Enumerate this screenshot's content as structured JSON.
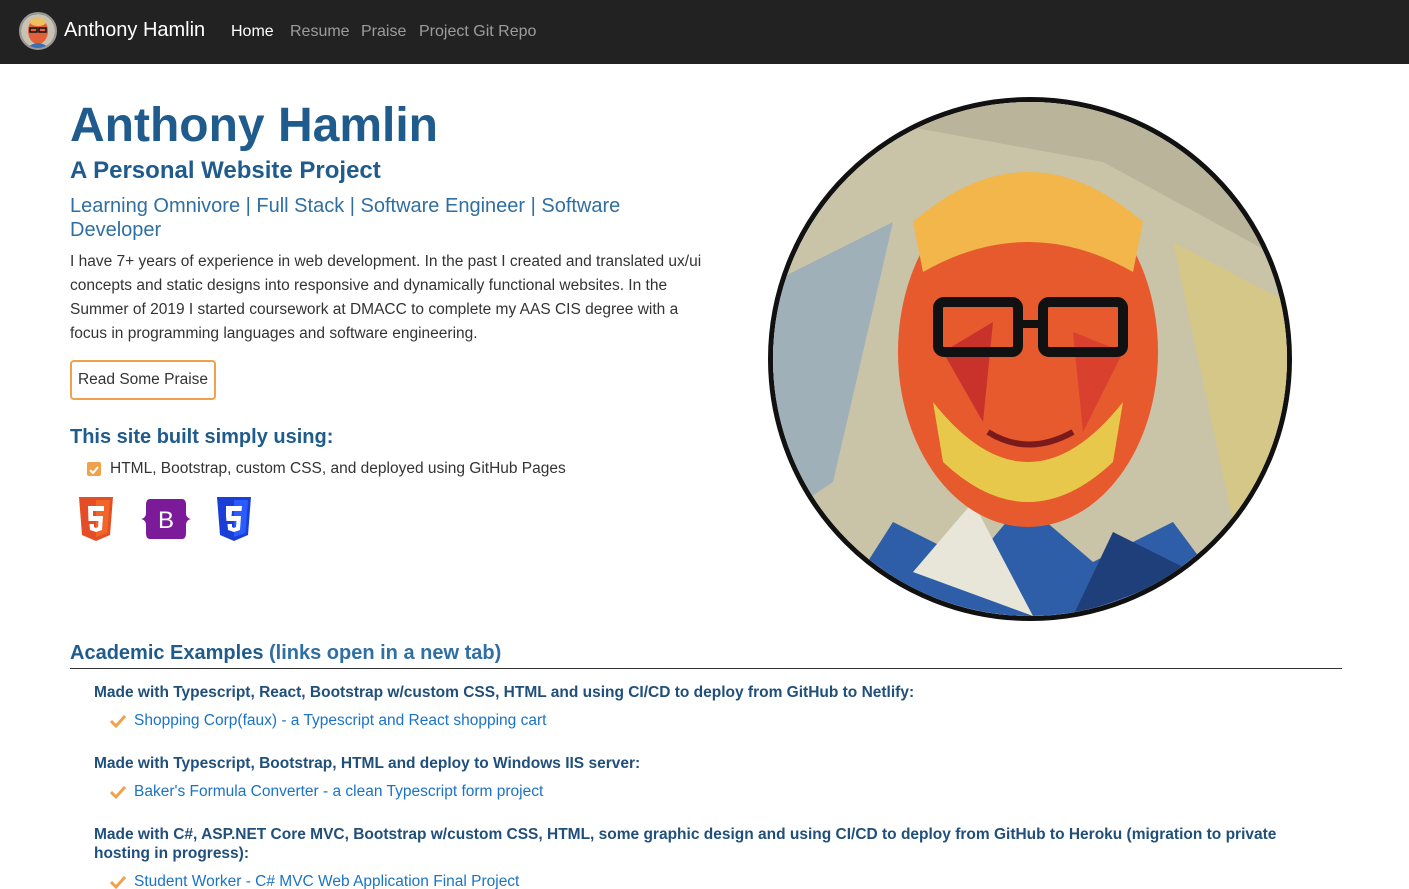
{
  "nav": {
    "brand": "Anthony Hamlin",
    "links": [
      "Home",
      "Resume",
      "Praise",
      "Project Git Repo"
    ]
  },
  "hero": {
    "title": "Anthony Hamlin",
    "subtitle": "A Personal Website Project",
    "tagline": "Learning Omnivore | Full Stack | Software Engineer | Software Developer",
    "description": "I have 7+ years of experience in web development. In the past I created and translated ux/ui concepts and static designs into responsive and dynamically functional websites. In the Summer of 2019 I started coursework at DMACC to complete my AAS CIS degree with a focus in programming languages and software engineering.",
    "button": "Read Some Praise"
  },
  "built": {
    "title": "This site built simply using:",
    "item": "HTML, Bootstrap, custom CSS, and deployed using GitHub Pages",
    "icons": [
      "html5-icon",
      "bootstrap-icon",
      "css3-icon"
    ],
    "bootstrap_letter": "B"
  },
  "academic": {
    "title": "Academic Examples",
    "note": "(links open in a new tab)",
    "groups": [
      {
        "heading": "Made with Typescript, React, Bootstrap w/custom CSS, HTML and using CI/CD to deploy from GitHub to Netlify:",
        "projects": [
          "Shopping Corp(faux) - a Typescript and React shopping cart"
        ]
      },
      {
        "heading": "Made with Typescript, Bootstrap, HTML and deploy to Windows IIS server:",
        "projects": [
          "Baker's Formula Converter - a clean Typescript form project"
        ]
      },
      {
        "heading": "Made with C#, ASP.NET Core MVC, Bootstrap w/custom CSS, HTML, some graphic design and using CI/CD to deploy from GitHub to Heroku (migration to private hosting in progress):",
        "projects": [
          "Student Worker - C# MVC Web Application Final Project"
        ]
      }
    ]
  },
  "colors": {
    "navbar": "#222222",
    "heading": "#1f5b8c",
    "accent": "#f0a14b",
    "link": "#1a73c7"
  }
}
